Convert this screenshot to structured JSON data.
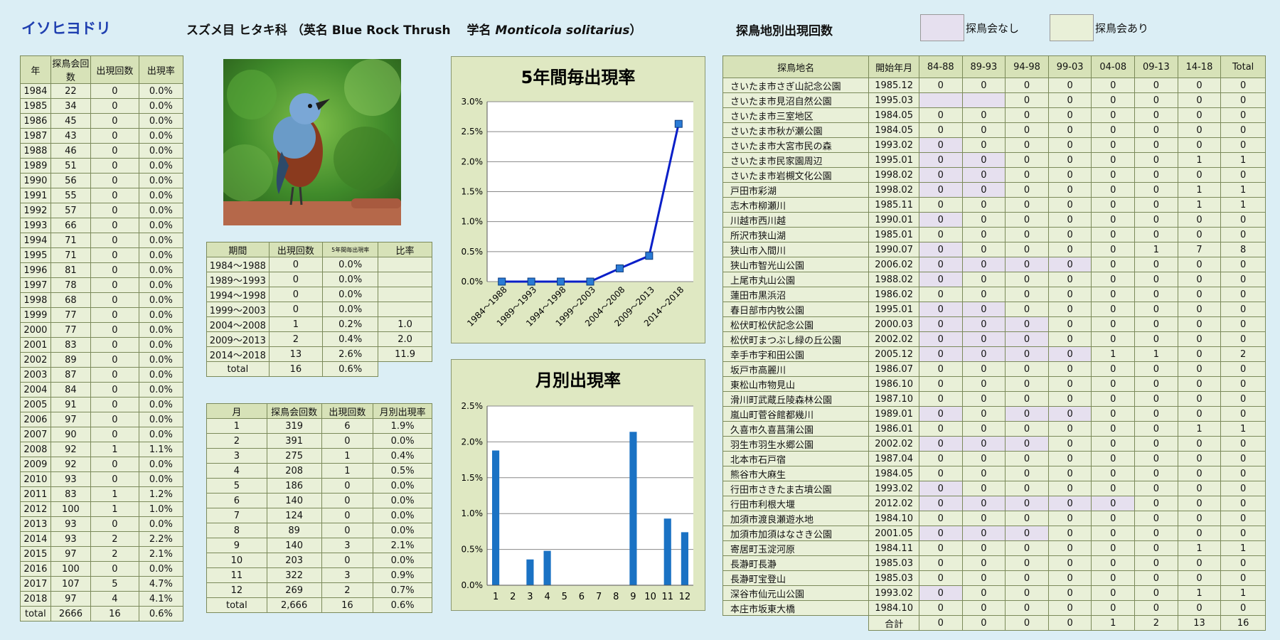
{
  "header": {
    "name": "イソヒヨドリ",
    "species_line_prefix": "スズメ目 ヒタキ科 （英名 Blue Rock Thrush　 学名 ",
    "species_scientific": "Monticola solitarius",
    "species_line_suffix": "）",
    "site_title": "探鳥地別出現回数",
    "legend_none": "探鳥会なし",
    "legend_has": "探鳥会あり"
  },
  "colors": {
    "no_event": "#e6e0ef",
    "has_event": "#e9f0d8",
    "bar": "#1a72c4",
    "line": "#0a1fc8",
    "marker": "#2a7bd6"
  },
  "yearly": {
    "headers": [
      "年",
      "探鳥会回数",
      "出現回数",
      "出現率"
    ],
    "rows": [
      [
        "1984",
        "22",
        "0",
        "0.0%"
      ],
      [
        "1985",
        "34",
        "0",
        "0.0%"
      ],
      [
        "1986",
        "45",
        "0",
        "0.0%"
      ],
      [
        "1987",
        "43",
        "0",
        "0.0%"
      ],
      [
        "1988",
        "46",
        "0",
        "0.0%"
      ],
      [
        "1989",
        "51",
        "0",
        "0.0%"
      ],
      [
        "1990",
        "56",
        "0",
        "0.0%"
      ],
      [
        "1991",
        "55",
        "0",
        "0.0%"
      ],
      [
        "1992",
        "57",
        "0",
        "0.0%"
      ],
      [
        "1993",
        "66",
        "0",
        "0.0%"
      ],
      [
        "1994",
        "71",
        "0",
        "0.0%"
      ],
      [
        "1995",
        "71",
        "0",
        "0.0%"
      ],
      [
        "1996",
        "81",
        "0",
        "0.0%"
      ],
      [
        "1997",
        "78",
        "0",
        "0.0%"
      ],
      [
        "1998",
        "68",
        "0",
        "0.0%"
      ],
      [
        "1999",
        "77",
        "0",
        "0.0%"
      ],
      [
        "2000",
        "77",
        "0",
        "0.0%"
      ],
      [
        "2001",
        "83",
        "0",
        "0.0%"
      ],
      [
        "2002",
        "89",
        "0",
        "0.0%"
      ],
      [
        "2003",
        "87",
        "0",
        "0.0%"
      ],
      [
        "2004",
        "84",
        "0",
        "0.0%"
      ],
      [
        "2005",
        "91",
        "0",
        "0.0%"
      ],
      [
        "2006",
        "97",
        "0",
        "0.0%"
      ],
      [
        "2007",
        "90",
        "0",
        "0.0%"
      ],
      [
        "2008",
        "92",
        "1",
        "1.1%"
      ],
      [
        "2009",
        "92",
        "0",
        "0.0%"
      ],
      [
        "2010",
        "93",
        "0",
        "0.0%"
      ],
      [
        "2011",
        "83",
        "1",
        "1.2%"
      ],
      [
        "2012",
        "100",
        "1",
        "1.0%"
      ],
      [
        "2013",
        "93",
        "0",
        "0.0%"
      ],
      [
        "2014",
        "93",
        "2",
        "2.2%"
      ],
      [
        "2015",
        "97",
        "2",
        "2.1%"
      ],
      [
        "2016",
        "100",
        "0",
        "0.0%"
      ],
      [
        "2017",
        "107",
        "5",
        "4.7%"
      ],
      [
        "2018",
        "97",
        "4",
        "4.1%"
      ],
      [
        "total",
        "2666",
        "16",
        "0.6%"
      ]
    ]
  },
  "period": {
    "headers": [
      "期間",
      "出現回数",
      "5年間毎出現率",
      "比率"
    ],
    "rows": [
      [
        "1984～1988",
        "0",
        "0.0%",
        ""
      ],
      [
        "1989～1993",
        "0",
        "0.0%",
        ""
      ],
      [
        "1994～1998",
        "0",
        "0.0%",
        ""
      ],
      [
        "1999～2003",
        "0",
        "0.0%",
        ""
      ],
      [
        "2004～2008",
        "1",
        "0.2%",
        "1.0"
      ],
      [
        "2009～2013",
        "2",
        "0.4%",
        "2.0"
      ],
      [
        "2014～2018",
        "13",
        "2.6%",
        "11.9"
      ],
      [
        "total",
        "16",
        "0.6%",
        ""
      ]
    ]
  },
  "monthly": {
    "headers": [
      "月",
      "探鳥会回数",
      "出現回数",
      "月別出現率"
    ],
    "rows": [
      [
        "1",
        "319",
        "6",
        "1.9%"
      ],
      [
        "2",
        "391",
        "0",
        "0.0%"
      ],
      [
        "3",
        "275",
        "1",
        "0.4%"
      ],
      [
        "4",
        "208",
        "1",
        "0.5%"
      ],
      [
        "5",
        "186",
        "0",
        "0.0%"
      ],
      [
        "6",
        "140",
        "0",
        "0.0%"
      ],
      [
        "7",
        "124",
        "0",
        "0.0%"
      ],
      [
        "8",
        "89",
        "0",
        "0.0%"
      ],
      [
        "9",
        "140",
        "3",
        "2.1%"
      ],
      [
        "10",
        "203",
        "0",
        "0.0%"
      ],
      [
        "11",
        "322",
        "3",
        "0.9%"
      ],
      [
        "12",
        "269",
        "2",
        "0.7%"
      ],
      [
        "total",
        "2,666",
        "16",
        "0.6%"
      ]
    ]
  },
  "chart_data": [
    {
      "type": "line",
      "title": "5年間毎出現率",
      "categories": [
        "1984～1988",
        "1989～1993",
        "1994～1998",
        "1999～2003",
        "2004～2008",
        "2009～2013",
        "2014～2018"
      ],
      "values": [
        0.0,
        0.0,
        0.0,
        0.0,
        0.22,
        0.43,
        2.63
      ],
      "ylim": [
        0,
        3.0
      ],
      "yticks": [
        "0.0%",
        "0.5%",
        "1.0%",
        "1.5%",
        "2.0%",
        "2.5%",
        "3.0%"
      ],
      "grid": true
    },
    {
      "type": "bar",
      "title": "月別出現率",
      "categories": [
        "1",
        "2",
        "3",
        "4",
        "5",
        "6",
        "7",
        "8",
        "9",
        "10",
        "11",
        "12"
      ],
      "values": [
        1.88,
        0.0,
        0.36,
        0.48,
        0.0,
        0.0,
        0.0,
        0.0,
        2.14,
        0.0,
        0.93,
        0.74
      ],
      "ylim": [
        0,
        2.5
      ],
      "yticks": [
        "0.0%",
        "0.5%",
        "1.0%",
        "1.5%",
        "2.0%",
        "2.5%"
      ],
      "grid": true
    }
  ],
  "sites": {
    "headers": [
      "探鳥地名",
      "開始年月",
      "84-88",
      "89-93",
      "94-98",
      "99-03",
      "04-08",
      "09-13",
      "14-18",
      "Total"
    ],
    "rows": [
      {
        "name": "さいたま市さぎ山記念公園",
        "start": "1985.12",
        "v": [
          "0",
          "0",
          "0",
          "0",
          "0",
          "0",
          "0",
          "0"
        ],
        "p": []
      },
      {
        "name": "さいたま市見沼自然公園",
        "start": "1995.03",
        "v": [
          "",
          "",
          "0",
          "0",
          "0",
          "0",
          "0",
          "0"
        ],
        "p": [
          0,
          1
        ]
      },
      {
        "name": "さいたま市三室地区",
        "start": "1984.05",
        "v": [
          "0",
          "0",
          "0",
          "0",
          "0",
          "0",
          "0",
          "0"
        ],
        "p": []
      },
      {
        "name": "さいたま市秋が瀬公園",
        "start": "1984.05",
        "v": [
          "0",
          "0",
          "0",
          "0",
          "0",
          "0",
          "0",
          "0"
        ],
        "p": []
      },
      {
        "name": "さいたま市大宮市民の森",
        "start": "1993.02",
        "v": [
          "0",
          "0",
          "0",
          "0",
          "0",
          "0",
          "0",
          "0"
        ],
        "p": [
          0
        ]
      },
      {
        "name": "さいたま市民家園周辺",
        "start": "1995.01",
        "v": [
          "0",
          "0",
          "0",
          "0",
          "0",
          "0",
          "1",
          "1"
        ],
        "p": [
          0,
          1
        ]
      },
      {
        "name": "さいたま市岩槻文化公園",
        "start": "1998.02",
        "v": [
          "0",
          "0",
          "0",
          "0",
          "0",
          "0",
          "0",
          "0"
        ],
        "p": [
          0,
          1
        ]
      },
      {
        "name": "戸田市彩湖",
        "start": "1998.02",
        "v": [
          "0",
          "0",
          "0",
          "0",
          "0",
          "0",
          "1",
          "1"
        ],
        "p": [
          0,
          1
        ]
      },
      {
        "name": "志木市柳瀬川",
        "start": "1985.11",
        "v": [
          "0",
          "0",
          "0",
          "0",
          "0",
          "0",
          "1",
          "1"
        ],
        "p": []
      },
      {
        "name": "川越市西川越",
        "start": "1990.01",
        "v": [
          "0",
          "0",
          "0",
          "0",
          "0",
          "0",
          "0",
          "0"
        ],
        "p": [
          0
        ]
      },
      {
        "name": "所沢市狭山湖",
        "start": "1985.01",
        "v": [
          "0",
          "0",
          "0",
          "0",
          "0",
          "0",
          "0",
          "0"
        ],
        "p": []
      },
      {
        "name": "狭山市入間川",
        "start": "1990.07",
        "v": [
          "0",
          "0",
          "0",
          "0",
          "0",
          "1",
          "7",
          "8"
        ],
        "p": [
          0
        ]
      },
      {
        "name": "狭山市智光山公園",
        "start": "2006.02",
        "v": [
          "0",
          "0",
          "0",
          "0",
          "0",
          "0",
          "0",
          "0"
        ],
        "p": [
          0,
          1,
          2,
          3
        ]
      },
      {
        "name": "上尾市丸山公園",
        "start": "1988.02",
        "v": [
          "0",
          "0",
          "0",
          "0",
          "0",
          "0",
          "0",
          "0"
        ],
        "p": [
          0
        ]
      },
      {
        "name": "蓮田市黒浜沼",
        "start": "1986.02",
        "v": [
          "0",
          "0",
          "0",
          "0",
          "0",
          "0",
          "0",
          "0"
        ],
        "p": []
      },
      {
        "name": "春日部市内牧公園",
        "start": "1995.01",
        "v": [
          "0",
          "0",
          "0",
          "0",
          "0",
          "0",
          "0",
          "0"
        ],
        "p": [
          0,
          1
        ]
      },
      {
        "name": "松伏町松伏記念公園",
        "start": "2000.03",
        "v": [
          "0",
          "0",
          "0",
          "0",
          "0",
          "0",
          "0",
          "0"
        ],
        "p": [
          0,
          1,
          2
        ]
      },
      {
        "name": "松伏町まつぶし緑の丘公園",
        "start": "2002.02",
        "v": [
          "0",
          "0",
          "0",
          "0",
          "0",
          "0",
          "0",
          "0"
        ],
        "p": [
          0,
          1,
          2
        ]
      },
      {
        "name": "幸手市宇和田公園",
        "start": "2005.12",
        "v": [
          "0",
          "0",
          "0",
          "0",
          "1",
          "1",
          "0",
          "2"
        ],
        "p": [
          0,
          1,
          2,
          3
        ]
      },
      {
        "name": "坂戸市高麗川",
        "start": "1986.07",
        "v": [
          "0",
          "0",
          "0",
          "0",
          "0",
          "0",
          "0",
          "0"
        ],
        "p": []
      },
      {
        "name": "東松山市物見山",
        "start": "1986.10",
        "v": [
          "0",
          "0",
          "0",
          "0",
          "0",
          "0",
          "0",
          "0"
        ],
        "p": []
      },
      {
        "name": "滑川町武蔵丘陵森林公園",
        "start": "1987.10",
        "v": [
          "0",
          "0",
          "0",
          "0",
          "0",
          "0",
          "0",
          "0"
        ],
        "p": []
      },
      {
        "name": "嵐山町菅谷館都幾川",
        "start": "1989.01",
        "v": [
          "0",
          "0",
          "0",
          "0",
          "0",
          "0",
          "0",
          "0"
        ],
        "p": [
          0,
          2,
          3
        ]
      },
      {
        "name": "久喜市久喜菖蒲公園",
        "start": "1986.01",
        "v": [
          "0",
          "0",
          "0",
          "0",
          "0",
          "0",
          "1",
          "1"
        ],
        "p": []
      },
      {
        "name": "羽生市羽生水郷公園",
        "start": "2002.02",
        "v": [
          "0",
          "0",
          "0",
          "0",
          "0",
          "0",
          "0",
          "0"
        ],
        "p": [
          0,
          1,
          2
        ]
      },
      {
        "name": "北本市石戸宿",
        "start": "1987.04",
        "v": [
          "0",
          "0",
          "0",
          "0",
          "0",
          "0",
          "0",
          "0"
        ],
        "p": []
      },
      {
        "name": "熊谷市大麻生",
        "start": "1984.05",
        "v": [
          "0",
          "0",
          "0",
          "0",
          "0",
          "0",
          "0",
          "0"
        ],
        "p": []
      },
      {
        "name": "行田市さきたま古墳公園",
        "start": "1993.02",
        "v": [
          "0",
          "0",
          "0",
          "0",
          "0",
          "0",
          "0",
          "0"
        ],
        "p": [
          0
        ]
      },
      {
        "name": "行田市利根大堰",
        "start": "2012.02",
        "v": [
          "0",
          "0",
          "0",
          "0",
          "0",
          "0",
          "0",
          "0"
        ],
        "p": [
          0,
          1,
          2,
          3,
          4
        ]
      },
      {
        "name": "加須市渡良瀬遊水地",
        "start": "1984.10",
        "v": [
          "0",
          "0",
          "0",
          "0",
          "0",
          "0",
          "0",
          "0"
        ],
        "p": []
      },
      {
        "name": "加須市加須はなさき公園",
        "start": "2001.05",
        "v": [
          "0",
          "0",
          "0",
          "0",
          "0",
          "0",
          "0",
          "0"
        ],
        "p": [
          0,
          1,
          2
        ]
      },
      {
        "name": "寄居町玉淀河原",
        "start": "1984.11",
        "v": [
          "0",
          "0",
          "0",
          "0",
          "0",
          "0",
          "1",
          "1"
        ],
        "p": []
      },
      {
        "name": "長瀞町長瀞",
        "start": "1985.03",
        "v": [
          "0",
          "0",
          "0",
          "0",
          "0",
          "0",
          "0",
          "0"
        ],
        "p": []
      },
      {
        "name": "長瀞町宝登山",
        "start": "1985.03",
        "v": [
          "0",
          "0",
          "0",
          "0",
          "0",
          "0",
          "0",
          "0"
        ],
        "p": []
      },
      {
        "name": "深谷市仙元山公園",
        "start": "1993.02",
        "v": [
          "0",
          "0",
          "0",
          "0",
          "0",
          "0",
          "1",
          "1"
        ],
        "p": [
          0
        ]
      },
      {
        "name": "本庄市坂東大橋",
        "start": "1984.10",
        "v": [
          "0",
          "0",
          "0",
          "0",
          "0",
          "0",
          "0",
          "0"
        ],
        "p": []
      }
    ],
    "total_label": "合計",
    "totals": [
      "0",
      "0",
      "0",
      "0",
      "1",
      "2",
      "13",
      "16"
    ]
  }
}
